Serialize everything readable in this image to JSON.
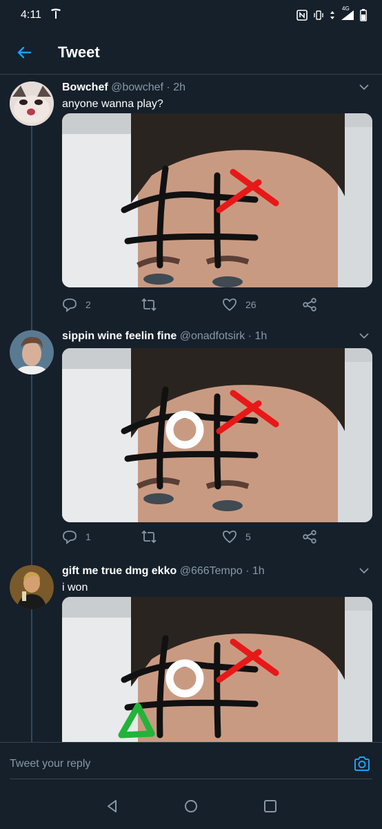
{
  "status_bar": {
    "time": "4:11",
    "network": "4G"
  },
  "header": {
    "title": "Tweet",
    "back_icon": "arrow-left-icon"
  },
  "colors": {
    "background": "#15202b",
    "accent": "#1da1f2",
    "muted": "#8899a6",
    "divider": "#38444d"
  },
  "tweets": [
    {
      "name": "Bowchef",
      "handle": "@bowchef",
      "separator": "·",
      "time": "2h",
      "text": "anyone wanna play?",
      "replies": "2",
      "likes": "26",
      "marks": [
        "x"
      ]
    },
    {
      "name": "sippin wine feelin fine",
      "handle": "@onadfotsirk",
      "separator": "·",
      "time": "1h",
      "text": "",
      "replies": "1",
      "likes": "5",
      "marks": [
        "x",
        "o"
      ]
    },
    {
      "name": "gift me true dmg ekko",
      "handle": "@666Tempo",
      "separator": "·",
      "time": "1h",
      "text": "i won",
      "replies": "",
      "likes": "",
      "marks": [
        "x",
        "o",
        "triangle"
      ]
    }
  ],
  "reply_bar": {
    "placeholder": "Tweet your reply",
    "camera_icon": "camera-icon"
  },
  "nav_bar": {
    "back_icon": "triangle-back-icon",
    "home_icon": "circle-home-icon",
    "recents_icon": "square-recents-icon"
  }
}
